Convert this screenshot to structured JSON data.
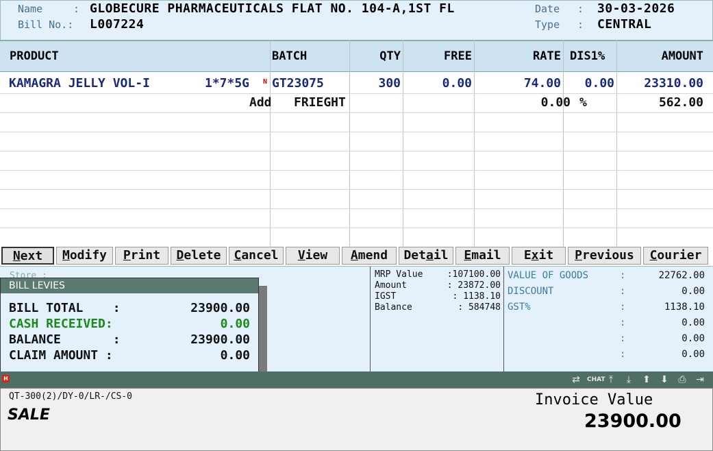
{
  "header": {
    "name_label": "Name",
    "name_value": "GLOBECURE PHARMACEUTICALS FLAT NO. 104-A,1ST FL",
    "bill_label": "Bill No.:",
    "bill_value": "L007224",
    "date_label": "Date",
    "date_value": "30-03-2026",
    "type_label": "Type",
    "type_value": "CENTRAL",
    "colon": ":"
  },
  "table": {
    "columns": [
      "PRODUCT",
      "BATCH",
      "QTY",
      "FREE",
      "RATE",
      "DIS1%",
      "AMOUNT"
    ],
    "row": {
      "product": "KAMAGRA JELLY VOL-I",
      "pack": "1*7*5G",
      "flag": "N",
      "batch": "GT23075",
      "qty": "300",
      "free": "0.00",
      "rate": "74.00",
      "dis": "0.00",
      "amount": "23310.00"
    },
    "freight": {
      "add": "Add",
      "label": "FRIEGHT",
      "percent_value": "0.00",
      "percent_sign": "%",
      "amount": "562.00"
    }
  },
  "buttons": [
    {
      "pre": "",
      "key": "N",
      "post": "ext"
    },
    {
      "pre": "",
      "key": "M",
      "post": "odify"
    },
    {
      "pre": "",
      "key": "P",
      "post": "rint"
    },
    {
      "pre": "",
      "key": "D",
      "post": "elete"
    },
    {
      "pre": "",
      "key": "C",
      "post": "ancel"
    },
    {
      "pre": "",
      "key": "V",
      "post": "iew"
    },
    {
      "pre": "",
      "key": "A",
      "post": "mend"
    },
    {
      "pre": "Det",
      "key": "a",
      "post": "il"
    },
    {
      "pre": "",
      "key": "E",
      "post": "mail"
    },
    {
      "pre": "E",
      "key": "x",
      "post": "it"
    },
    {
      "pre": "",
      "key": "P",
      "post": "revious"
    },
    {
      "pre": "",
      "key": "C",
      "post": "ourier"
    }
  ],
  "store_label": "Store :",
  "mid_panel": [
    {
      "k": "MRP Value",
      "v": ":107100.00"
    },
    {
      "k": "Amount",
      "v": ": 23872.00"
    },
    {
      "k": "IGST",
      "v": ":  1138.10"
    },
    {
      "k": "Balance",
      "v": ":   584748"
    }
  ],
  "right_panel": [
    {
      "k": "VALUE OF GOODS",
      "c": ":",
      "v": "22762.00"
    },
    {
      "k": "DISCOUNT",
      "c": ":",
      "v": "0.00"
    },
    {
      "k": "GST%",
      "c": ":",
      "v": "1138.10"
    },
    {
      "k": "",
      "c": ":",
      "v": "0.00"
    },
    {
      "k": "",
      "c": ":",
      "v": "0.00"
    },
    {
      "k": "",
      "c": ":",
      "v": "0.00"
    }
  ],
  "levies": {
    "title": "BILL LEVIES",
    "rows": [
      {
        "k": "BILL TOTAL    :",
        "v": "23900.00"
      },
      {
        "k": "CASH RECEIVED:",
        "v": "0.00"
      },
      {
        "k": "BALANCE       :",
        "v": "23900.00"
      },
      {
        "k": "CLAIM AMOUNT :",
        "v": "0.00"
      }
    ]
  },
  "strip": {
    "badge": "H",
    "icons": [
      "shuffle-icon",
      "chat-icon",
      "top-icon",
      "bottom-icon",
      "up-icon",
      "down-icon",
      "printer-icon",
      "exit-icon"
    ],
    "chat_label": "CHAT"
  },
  "footer": {
    "qt_text": "QT-300(2)/DY-0/LR-/CS-0",
    "mode": "SALE",
    "invoice_label": "Invoice Value",
    "invoice_value": "23900.00"
  }
}
